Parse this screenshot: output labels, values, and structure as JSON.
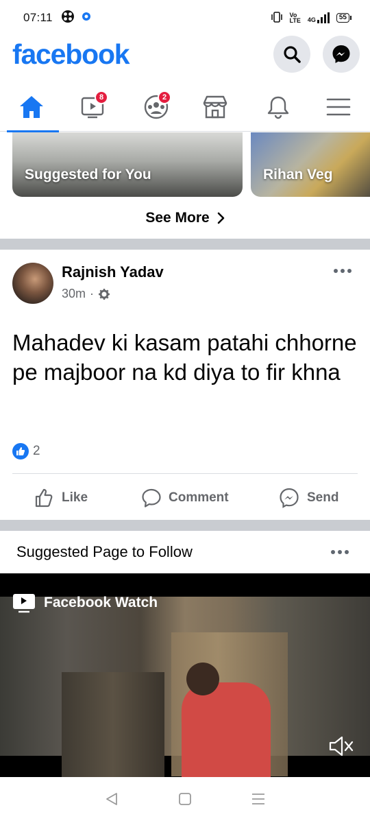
{
  "status_bar": {
    "time": "07:11",
    "network": "4G",
    "battery": "55"
  },
  "header": {
    "logo": "facebook",
    "search_icon": "search-icon",
    "messenger_icon": "messenger-icon"
  },
  "tabs": {
    "items": [
      {
        "name": "home",
        "icon": "home-icon",
        "active": true
      },
      {
        "name": "watch",
        "icon": "video-icon",
        "badge": "8"
      },
      {
        "name": "groups",
        "icon": "groups-icon",
        "badge": "2"
      },
      {
        "name": "marketplace",
        "icon": "store-icon"
      },
      {
        "name": "notifications",
        "icon": "bell-icon"
      },
      {
        "name": "menu",
        "icon": "hamburger-icon"
      }
    ]
  },
  "suggested": {
    "cards": [
      {
        "label": "Suggested for You"
      },
      {
        "label": "Rihan Veg"
      }
    ],
    "see_more": "See More"
  },
  "post": {
    "author": "Rajnish Yadav",
    "time": "30m",
    "text": "Mahadev ki kasam patahi chhorne pe majboor na kd diya to fir khna",
    "reaction_count": "2",
    "actions": {
      "like": "Like",
      "comment": "Comment",
      "send": "Send"
    }
  },
  "suggested_page": {
    "title": "Suggested Page to Follow",
    "video_label": "Facebook Watch"
  },
  "colors": {
    "brand": "#1877f2",
    "badge": "#e41e3f",
    "divider": "#c9ccd1"
  }
}
